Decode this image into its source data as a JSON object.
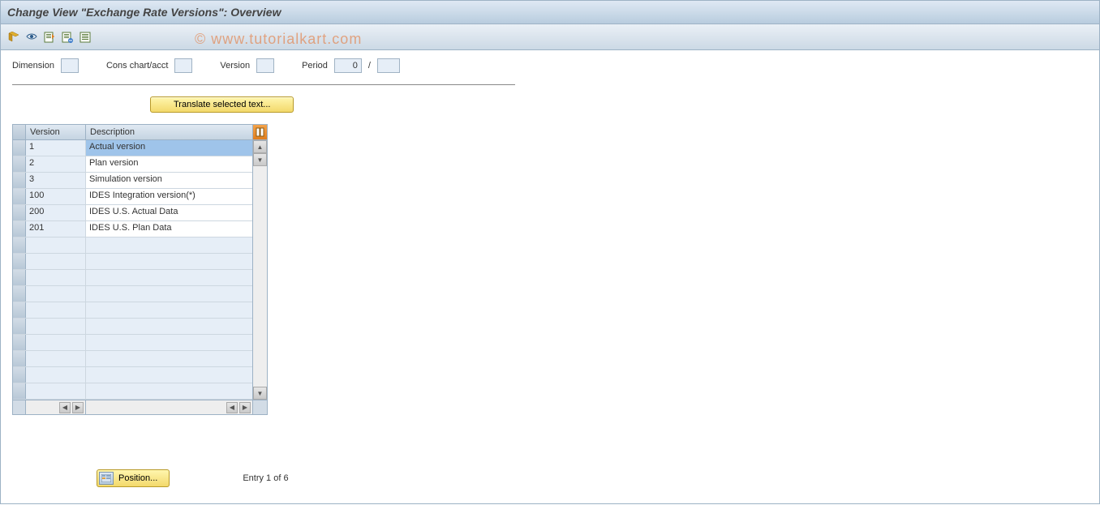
{
  "title": "Change View \"Exchange Rate Versions\": Overview",
  "watermark": "© www.tutorialkart.com",
  "toolbar": {
    "icons": [
      "toggle-display-icon",
      "new-entries-icon",
      "copy-icon",
      "delete-icon",
      "select-icon"
    ]
  },
  "filters": {
    "dimension_label": "Dimension",
    "cons_chart_label": "Cons chart/acct",
    "version_label": "Version",
    "period_label": "Period",
    "period_value": "0",
    "period_sep": "/"
  },
  "translate_button": "Translate selected text...",
  "table": {
    "headers": {
      "version": "Version",
      "description": "Description"
    },
    "rows": [
      {
        "version": "1",
        "description": "Actual version",
        "selected": true
      },
      {
        "version": "2",
        "description": "Plan version"
      },
      {
        "version": "3",
        "description": "Simulation version"
      },
      {
        "version": "100",
        "description": "IDES Integration version(*)"
      },
      {
        "version": "200",
        "description": "IDES U.S. Actual Data"
      },
      {
        "version": "201",
        "description": "IDES U.S. Plan Data"
      }
    ],
    "empty_rows": 10
  },
  "footer": {
    "position_label": "Position...",
    "entry_text": "Entry 1 of 6"
  }
}
